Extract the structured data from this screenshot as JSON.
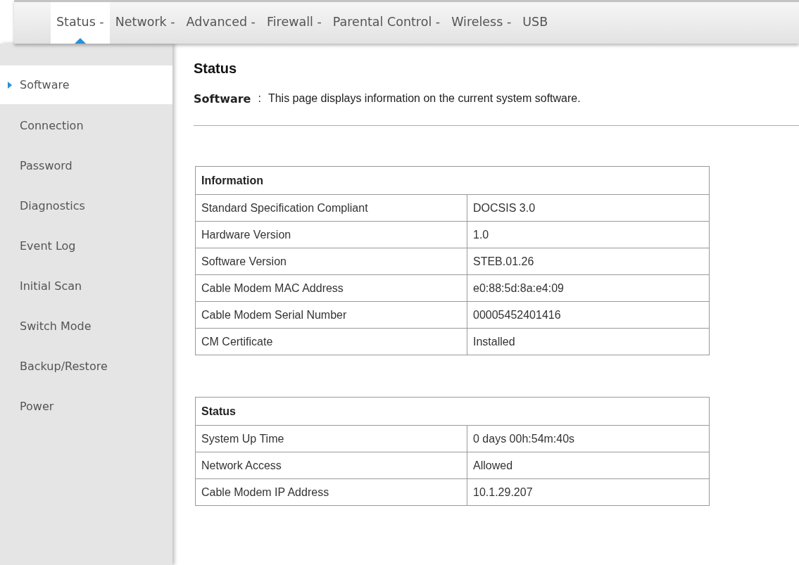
{
  "nav": [
    {
      "label": "Status -",
      "selected": true
    },
    {
      "label": "Network -",
      "selected": false
    },
    {
      "label": "Advanced -",
      "selected": false
    },
    {
      "label": "Firewall -",
      "selected": false
    },
    {
      "label": "Parental Control -",
      "selected": false
    },
    {
      "label": "Wireless -",
      "selected": false
    },
    {
      "label": "USB",
      "selected": false
    }
  ],
  "sidebar": {
    "items": [
      {
        "label": "Software",
        "selected": true
      },
      {
        "label": "Connection",
        "selected": false
      },
      {
        "label": "Password",
        "selected": false
      },
      {
        "label": "Diagnostics",
        "selected": false
      },
      {
        "label": "Event Log",
        "selected": false
      },
      {
        "label": "Initial Scan",
        "selected": false
      },
      {
        "label": "Switch Mode",
        "selected": false
      },
      {
        "label": "Backup/Restore",
        "selected": false
      },
      {
        "label": "Power",
        "selected": false
      }
    ]
  },
  "page": {
    "title": "Status",
    "description_label": "Software",
    "description_separator": ":",
    "description": "This page displays information on the current system software."
  },
  "tables": [
    {
      "title": "Information",
      "rows": [
        [
          "Standard Specification Compliant",
          "DOCSIS 3.0"
        ],
        [
          "Hardware Version",
          "1.0"
        ],
        [
          "Software Version",
          "STEB.01.26"
        ],
        [
          "Cable Modem MAC Address",
          "e0:88:5d:8a:e4:09"
        ],
        [
          "Cable Modem Serial Number",
          "00005452401416"
        ],
        [
          "CM Certificate",
          "Installed"
        ]
      ]
    },
    {
      "title": "Status",
      "rows": [
        [
          "System Up Time",
          "0 days 00h:54m:40s"
        ],
        [
          "Network Access",
          "Allowed"
        ],
        [
          "Cable Modem IP Address",
          "10.1.29.207"
        ]
      ]
    }
  ]
}
